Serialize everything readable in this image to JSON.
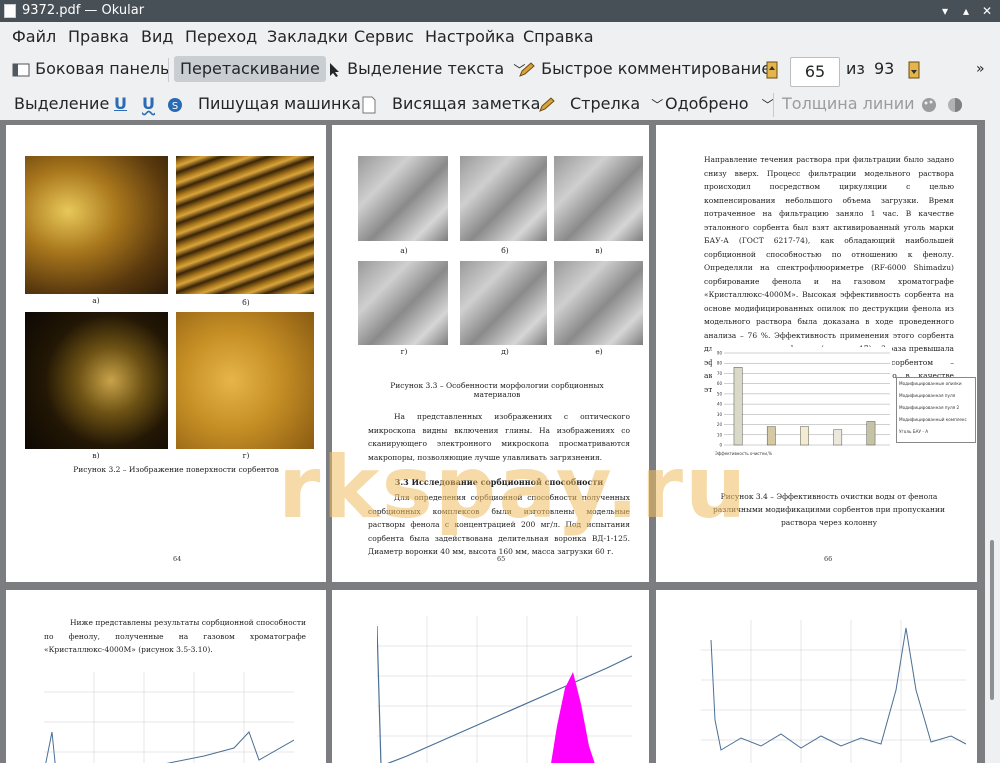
{
  "window": {
    "title": "9372.pdf — Okular"
  },
  "menu": [
    "Файл",
    "Правка",
    "Вид",
    "Переход",
    "Закладки",
    "Сервис",
    "Настройка",
    "Справка"
  ],
  "toolbar1": {
    "sidebar": "Боковая панель",
    "browse": "Перетаскивание",
    "text_select": "Выделение текста",
    "quick_annot": "Быстрое комментирование",
    "page_current": "65",
    "page_of": "из",
    "page_total": "93"
  },
  "toolbar2": {
    "select": "Выделение",
    "typewriter": "Пишущая машинка",
    "note": "Висящая заметка",
    "arrow": "Стрелка",
    "stamp": "Одобрено",
    "line_width": "Толщина линии"
  },
  "watermark": "rkspay.ru",
  "pages": {
    "p64": {
      "labels": [
        "а)",
        "б)",
        "в)",
        "г)"
      ],
      "caption": "Рисунок 3.2 – Изображение поверхности сорбентов",
      "number": "64"
    },
    "p65": {
      "labels": [
        "а)",
        "б)",
        "в)",
        "г)",
        "д)",
        "е)"
      ],
      "caption": "Рисунок 3.3 – Особенности морфологии сорбционных материалов",
      "para1": "На представленных изображениях с оптического микроскопа видны включения глины. На изображениях со сканирующего электронного микроскопа просматриваются макропоры, позволяющие лучше улавливать загрязнения.",
      "heading": "3.3 Исследование сорбционной способности",
      "para2": "Для определения сорбционной способности полученных сорбционных комплексов были изготовлены модельные растворы фенола с концентрацией 200 мг/л. Под испытания сорбента была задействована делительная воронка ВД-1-125. Диаметр воронки 40 мм, высота 160 мм, масса загрузки 60 г.",
      "number": "65"
    },
    "p66": {
      "para": "Направление течения раствора при фильтрации было задано снизу вверх. Процесс фильтрации модельного раствора происходил посредством циркуляции с целью компенсирования небольшого объема загрузки. Время потраченное на фильтрацию заняло 1 час. В качестве эталонного сорбента был взят активированный уголь марки БАУ-А (ГОСТ 6217-74), как обладающий наибольшей сорбционной способностью по отношению к фенолу. Определяли на спектрофлюориметре (RF-6000 Shimadzu) сорбирование фенола и на газовом хроматографе «Кристаллюкс-4000М». Высокая эффективность сорбента на основе модифицированных опилок по деструкции фенола из модельного раствора была доказана в ходе проведенного анализа – 76 %. Эффективность применения этого сорбента для очистки воды от фенола (рисунок 17) в 3 раза превышала эффективность очистки известным сорбентом – активированным углём БАУ – А, взятого в качестве эталонного для сравнения.",
      "chart_xlabel": "Эффективность очистки,%",
      "legend": [
        "Модифицированные опилки",
        "Модифицированная пуля",
        "Модифицированная пуля 2",
        "Модифицированный комплекс",
        "Уголь БАУ - А"
      ],
      "caption": "Рисунок 3.4 – Эффективность очистки воды от фенола различными модификациями сорбентов при пропускании раствора через колонну",
      "number": "66"
    },
    "p67": {
      "para": "Ниже представлены результаты сорбционной способности по фенолу, полученные на газовом хроматографе «Кристаллюкс-4000М» (рисунок 3.5-3.10)."
    }
  },
  "chart_data": {
    "type": "bar",
    "categories": [
      "Эффективность очистки,%"
    ],
    "series": [
      {
        "name": "Модифицированные опилки",
        "values": [
          76
        ]
      },
      {
        "name": "Модифицированная пуля",
        "values": [
          18
        ]
      },
      {
        "name": "Модифицированная пуля 2",
        "values": [
          18
        ]
      },
      {
        "name": "Модифицированный комплекс",
        "values": [
          15
        ]
      },
      {
        "name": "Уголь БАУ - А",
        "values": [
          23
        ]
      }
    ],
    "ylim": [
      0,
      90
    ],
    "yticks": [
      0,
      10,
      20,
      30,
      40,
      50,
      60,
      70,
      80,
      90
    ],
    "legend": "right",
    "grid": true
  },
  "colors": {
    "titlebar": "#475057",
    "toolbar": "#eff0f1",
    "viewport": "#7b7d80",
    "peak": "#ff00ff",
    "series_line": "#4a6f95"
  }
}
